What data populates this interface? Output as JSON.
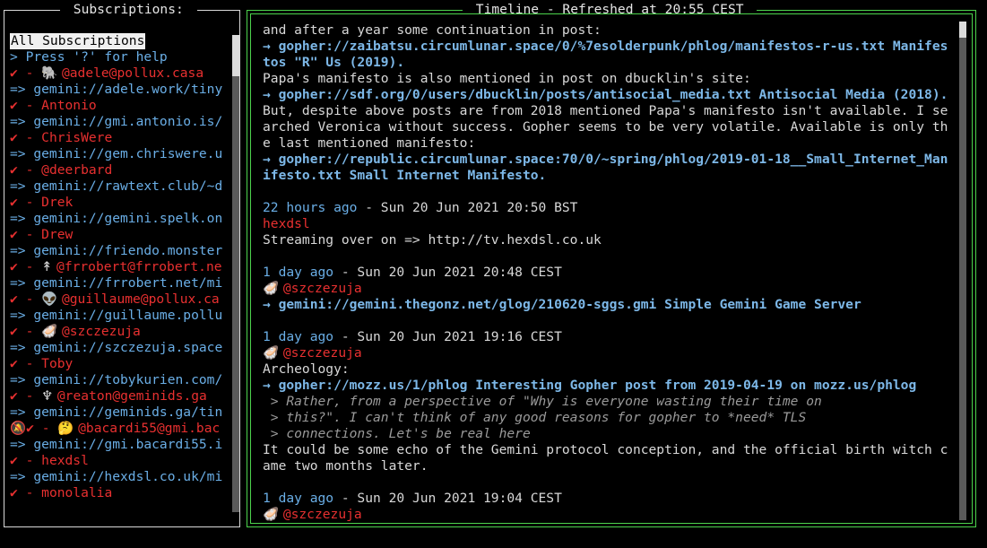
{
  "subscriptions": {
    "title": " Subscriptions: ",
    "all_label": "All Subscriptions",
    "help": "> Press '?' for help",
    "items": [
      {
        "mark": "✔ - ",
        "emoji": "🐘 ",
        "name": "@adele@pollux.casa",
        "url": "=> gemini://adele.work/tiny"
      },
      {
        "mark": "✔ - ",
        "emoji": "",
        "name": "Antonio",
        "url": "=> gemini://gmi.antonio.is/"
      },
      {
        "mark": "✔ - ",
        "emoji": "",
        "name": "ChrisWere",
        "url": "=> gemini://gem.chriswere.u"
      },
      {
        "mark": "✔ - ",
        "emoji": "",
        "name": "@deerbard",
        "url": "=> gemini://rawtext.club/~d"
      },
      {
        "mark": "✔ - ",
        "emoji": "",
        "name": "Drek",
        "url": "=> gemini://gemini.spelk.on"
      },
      {
        "mark": "✔ - ",
        "emoji": "",
        "name": "Drew",
        "url": "=> gemini://friendo.monster"
      },
      {
        "mark": "✔ - ",
        "emoji": "↟ ",
        "name": "@frrobert@frrobert.ne",
        "url": "=> gemini://frrobert.net/mi"
      },
      {
        "mark": "✔ - ",
        "emoji": "👽 ",
        "name": "@guillaume@pollux.ca",
        "url": "=> gemini://guillaume.pollu"
      },
      {
        "mark": "✔ - ",
        "emoji": "🦪 ",
        "name": "@szczezuja",
        "url": "=> gemini://szczezuja.space"
      },
      {
        "mark": "✔ - ",
        "emoji": "",
        "name": "Toby",
        "url": "=> gemini://tobykurien.com/"
      },
      {
        "mark": "✔ - ",
        "emoji": "♆ ",
        "name": "@reaton@geminids.ga",
        "url": "=> gemini://geminids.ga/tin"
      },
      {
        "mark": "🔕✔ - ",
        "emoji": "🤔 ",
        "name": "@bacardi55@gmi.bac",
        "url": "=> gemini://gmi.bacardi55.i"
      },
      {
        "mark": "✔ - ",
        "emoji": "",
        "name": "hexdsl",
        "url": "=> gemini://hexdsl.co.uk/mi"
      },
      {
        "mark": "✔ - ",
        "emoji": "",
        "name": "monolalia",
        "url": ""
      }
    ]
  },
  "timeline": {
    "title": " Timeline - Refreshed at 20:55 CEST ",
    "lines": [
      {
        "type": "text",
        "text": "and after a year some continuation in post:"
      },
      {
        "type": "link",
        "text": "→ gopher://zaibatsu.circumlunar.space/0/%7esolderpunk/phlog/manifestos-r-us.txt Manifes"
      },
      {
        "type": "link",
        "text": "tos \"R\" Us (2019)."
      },
      {
        "type": "text",
        "text": "Papa's manifesto is also mentioned in post on dbucklin's site:"
      },
      {
        "type": "link",
        "text": "→ gopher://sdf.org/0/users/dbucklin/posts/antisocial_media.txt Antisocial Media (2018)."
      },
      {
        "type": "text",
        "text": "But, despite above posts are from 2018 mentioned Papa's manifesto isn't available. I se"
      },
      {
        "type": "text",
        "text": "arched Veronica without success. Gopher seems to be very volatile. Available is only th"
      },
      {
        "type": "text",
        "text": "e last mentioned manifesto:"
      },
      {
        "type": "link",
        "text": "→ gopher://republic.circumlunar.space:70/0/~spring/phlog/2019-01-18__Small_Internet_Man"
      },
      {
        "type": "link",
        "text": "ifesto.txt Small Internet Manifesto."
      },
      {
        "type": "gap",
        "text": ""
      },
      {
        "type": "date",
        "ago": "22 hours ago",
        "rest": " - Sun 20 Jun 2021 20:50 BST"
      },
      {
        "type": "author",
        "text": "hexdsl"
      },
      {
        "type": "text",
        "text": "Streaming over on => http://tv.hexdsl.co.uk"
      },
      {
        "type": "gap",
        "text": ""
      },
      {
        "type": "date",
        "ago": "1 day ago",
        "rest": " - Sun 20 Jun 2021 20:48 CEST"
      },
      {
        "type": "author",
        "emoji": "🦪 ",
        "text": "@szczezuja"
      },
      {
        "type": "link",
        "text": "→ gemini://gemini.thegonz.net/glog/210620-sggs.gmi Simple Gemini Game Server"
      },
      {
        "type": "gap",
        "text": ""
      },
      {
        "type": "date",
        "ago": "1 day ago",
        "rest": " - Sun 20 Jun 2021 19:16 CEST"
      },
      {
        "type": "author",
        "emoji": "🦪 ",
        "text": "@szczezuja"
      },
      {
        "type": "text",
        "text": "Archeology:"
      },
      {
        "type": "link",
        "text": "→ gopher://mozz.us/1/phlog Interesting Gopher post from 2019-04-19 on mozz.us/phlog"
      },
      {
        "type": "quote",
        "text": " > Rather, from a perspective of \"Why is everyone wasting their time on"
      },
      {
        "type": "quote",
        "text": " > this?\". I can't think of any good reasons for gopher to *need* TLS"
      },
      {
        "type": "quote",
        "text": " > connections. Let's be real here"
      },
      {
        "type": "text",
        "text": "It could be some echo of the Gemini protocol conception, and the official birth witch c"
      },
      {
        "type": "text",
        "text": "ame two months later."
      },
      {
        "type": "gap",
        "text": ""
      },
      {
        "type": "date",
        "ago": "1 day ago",
        "rest": " - Sun 20 Jun 2021 19:04 CEST"
      },
      {
        "type": "author",
        "emoji": "🦪 ",
        "text": "@szczezuja"
      }
    ]
  },
  "colors": {
    "accent_green": "#4cd34c",
    "name_red": "#e83030",
    "url_blue": "#6aaee6",
    "link_blue": "#7db8e8"
  }
}
